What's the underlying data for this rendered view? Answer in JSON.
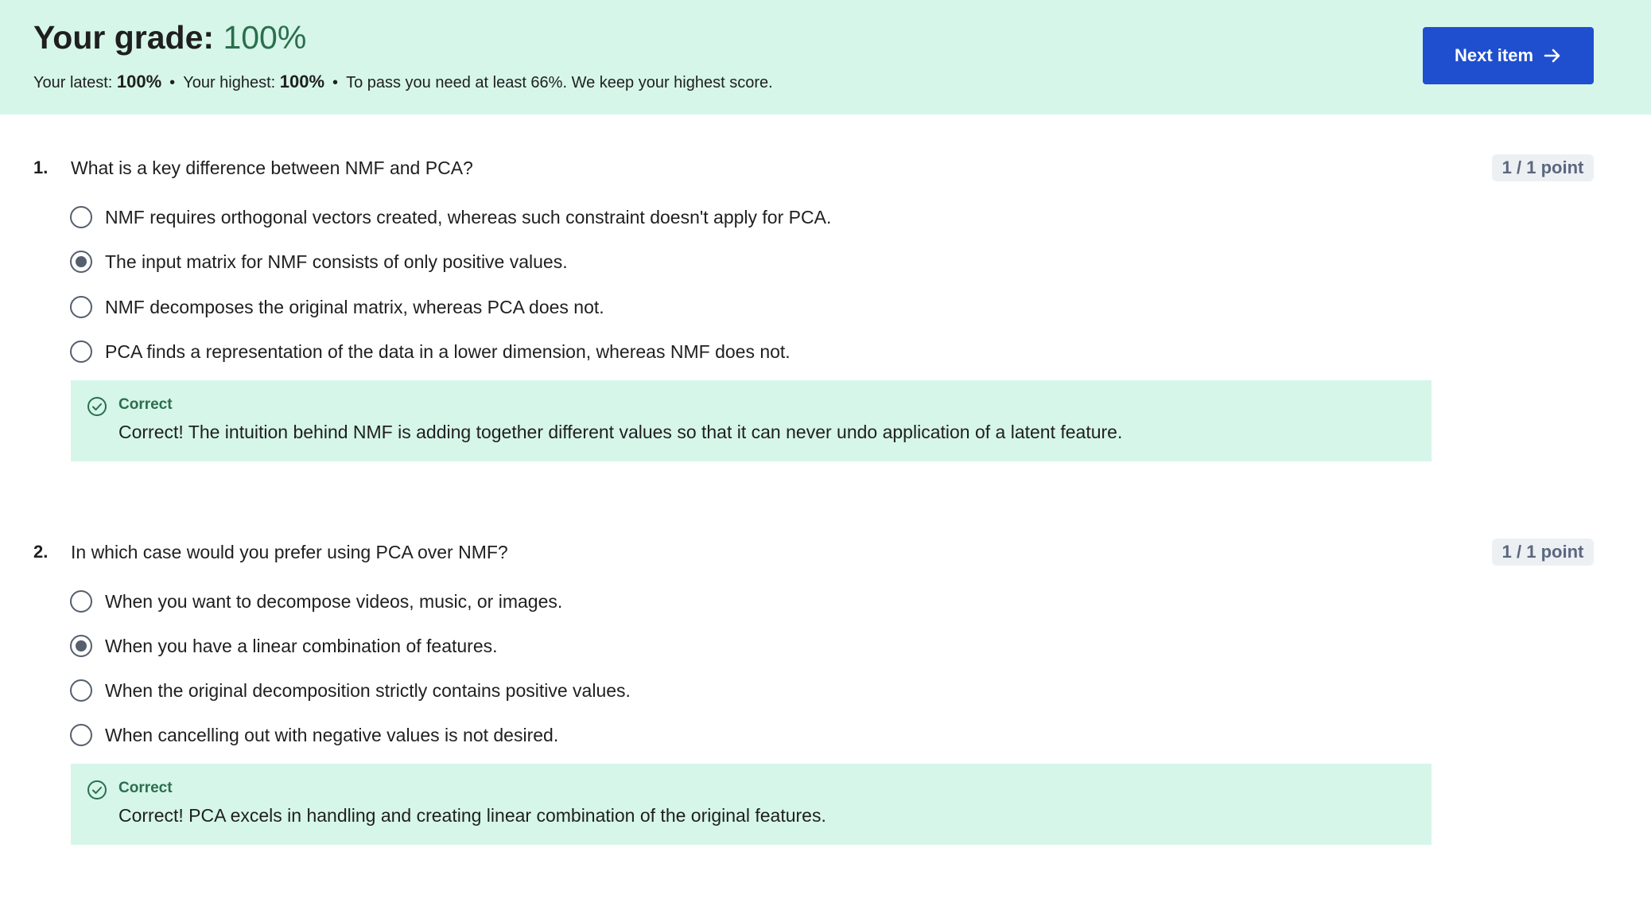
{
  "header": {
    "grade_label": "Your grade: ",
    "grade_value": "100%",
    "latest_label": "Your latest: ",
    "latest_value": "100%",
    "highest_label": "Your highest: ",
    "highest_value": "100%",
    "bullet": "•",
    "pass_text": "To pass you need at least 66%. We keep your highest score.",
    "next_button_label": "Next item",
    "next_button_icon": "arrow-right-icon"
  },
  "colors": {
    "header_bg": "#d6f6ea",
    "grade_green": "#2b6e4c",
    "primary_button": "#1f4fcf",
    "feedback_bg": "#d6f6ea",
    "points_bg": "#edf0f3",
    "points_text": "#5b6780"
  },
  "questions": [
    {
      "number": "1.",
      "text": "What is a key difference between NMF and PCA?",
      "points": "1 / 1 point",
      "options": [
        {
          "label": "NMF requires orthogonal vectors created, whereas such constraint doesn't apply for PCA.",
          "selected": false
        },
        {
          "label": "The input matrix for NMF consists of only positive values.",
          "selected": true
        },
        {
          "label": "NMF decomposes the original matrix, whereas PCA does not.",
          "selected": false
        },
        {
          "label": "PCA finds a representation of the data in a lower dimension, whereas NMF does not.",
          "selected": false
        }
      ],
      "feedback": {
        "icon": "check-circle-icon",
        "title": "Correct",
        "text": "Correct! The intuition behind NMF is adding together different values so that it can never undo application of a latent feature."
      }
    },
    {
      "number": "2.",
      "text": "In which case would you prefer using PCA over NMF?",
      "points": "1 / 1 point",
      "options": [
        {
          "label": "When you want to decompose videos, music, or images.",
          "selected": false
        },
        {
          "label": "When you have a linear combination of features.",
          "selected": true
        },
        {
          "label": "When the original decomposition strictly contains positive values.",
          "selected": false
        },
        {
          "label": "When cancelling out with negative values is not desired.",
          "selected": false
        }
      ],
      "feedback": {
        "icon": "check-circle-icon",
        "title": "Correct",
        "text": "Correct! PCA excels in handling and creating linear combination of the original features."
      }
    }
  ]
}
